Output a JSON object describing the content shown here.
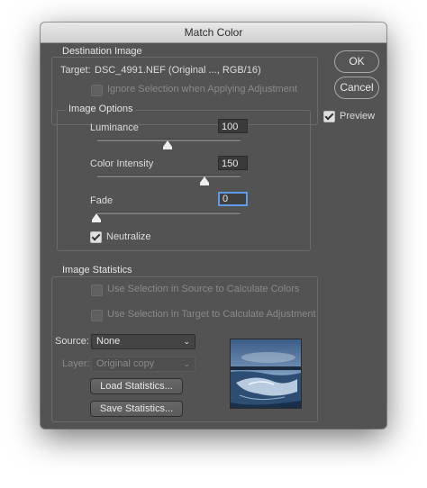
{
  "window": {
    "title": "Match Color"
  },
  "destination": {
    "title": "Destination Image",
    "target_label": "Target:",
    "target_value": "DSC_4991.NEF (Original ..., RGB/16)",
    "ignore_selection_label": "Ignore Selection when Applying Adjustment",
    "ignore_selection_checked": false,
    "ignore_selection_enabled": false
  },
  "image_options": {
    "title": "Image Options",
    "luminance": {
      "label": "Luminance",
      "value": "100",
      "slider_fraction": 0.5
    },
    "color_intensity": {
      "label": "Color Intensity",
      "value": "150",
      "slider_fraction": 0.75
    },
    "fade": {
      "label": "Fade",
      "value": "0",
      "slider_fraction": 0.0
    },
    "neutralize": {
      "label": "Neutralize",
      "checked": true
    }
  },
  "image_statistics": {
    "title": "Image Statistics",
    "use_source_selection_label": "Use Selection in Source to Calculate Colors",
    "use_target_selection_label": "Use Selection in Target to Calculate Adjustment",
    "source_label": "Source:",
    "source_value": "None",
    "layer_label": "Layer:",
    "layer_value": "Original copy",
    "load_button": "Load Statistics...",
    "save_button": "Save Statistics..."
  },
  "buttons": {
    "ok": "OK",
    "cancel": "Cancel"
  },
  "preview": {
    "label": "Preview",
    "checked": true
  },
  "colors": {
    "dialog_bg": "#535353",
    "focus_ring": "#5e9ae8"
  }
}
